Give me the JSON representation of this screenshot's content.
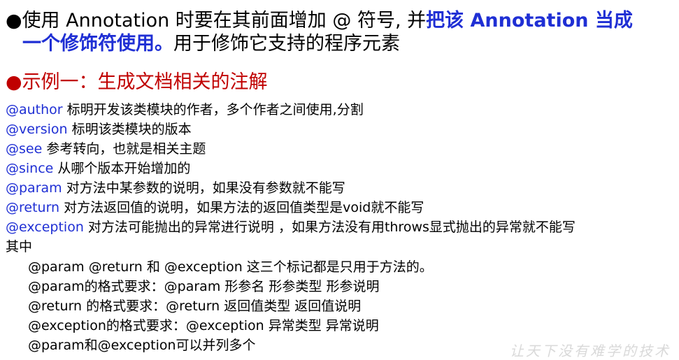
{
  "intro": {
    "bullet": "●",
    "part1": "使用 Annotation 时要在其前面增加 @ 符号, 并",
    "part1_emph": "把该 Annotation 当成",
    "line2_emph": "一个修饰符使用。",
    "line2_rest": "用于修饰它支持的程序元素"
  },
  "example": {
    "bullet": "●",
    "title": "示例一：生成文档相关的注解"
  },
  "tags": [
    {
      "tag": "@author",
      "desc": " 标明开发该类模块的作者，多个作者之间使用,分割"
    },
    {
      "tag": "@version",
      "desc": " 标明该类模块的版本"
    },
    {
      "tag": "@see",
      "desc": " 参考转向，也就是相关主题"
    },
    {
      "tag": "@since",
      "desc": " 从哪个版本开始增加的"
    },
    {
      "tag": "@param",
      "desc": " 对方法中某参数的说明，如果没有参数就不能写"
    },
    {
      "tag": "@return",
      "desc": " 对方法返回值的说明，如果方法的返回值类型是void就不能写"
    },
    {
      "tag": "@exception",
      "desc": " 对方法可能抛出的异常进行说明 ，如果方法没有用throws显式抛出的异常就不能写"
    }
  ],
  "exception_wrap": "其中",
  "notes": [
    "@param  @return 和 @exception 这三个标记都是只用于方法的。",
    "@param的格式要求：@param 形参名 形参类型  形参说明",
    "@return 的格式要求：@return 返回值类型 返回值说明",
    "@exception的格式要求：@exception 异常类型 异常说明",
    "@param和@exception可以并列多个"
  ],
  "watermark": "让天下没有难学的技术",
  "colors": {
    "accent_blue": "#1f2fd4",
    "heading_red": "#c00000"
  }
}
